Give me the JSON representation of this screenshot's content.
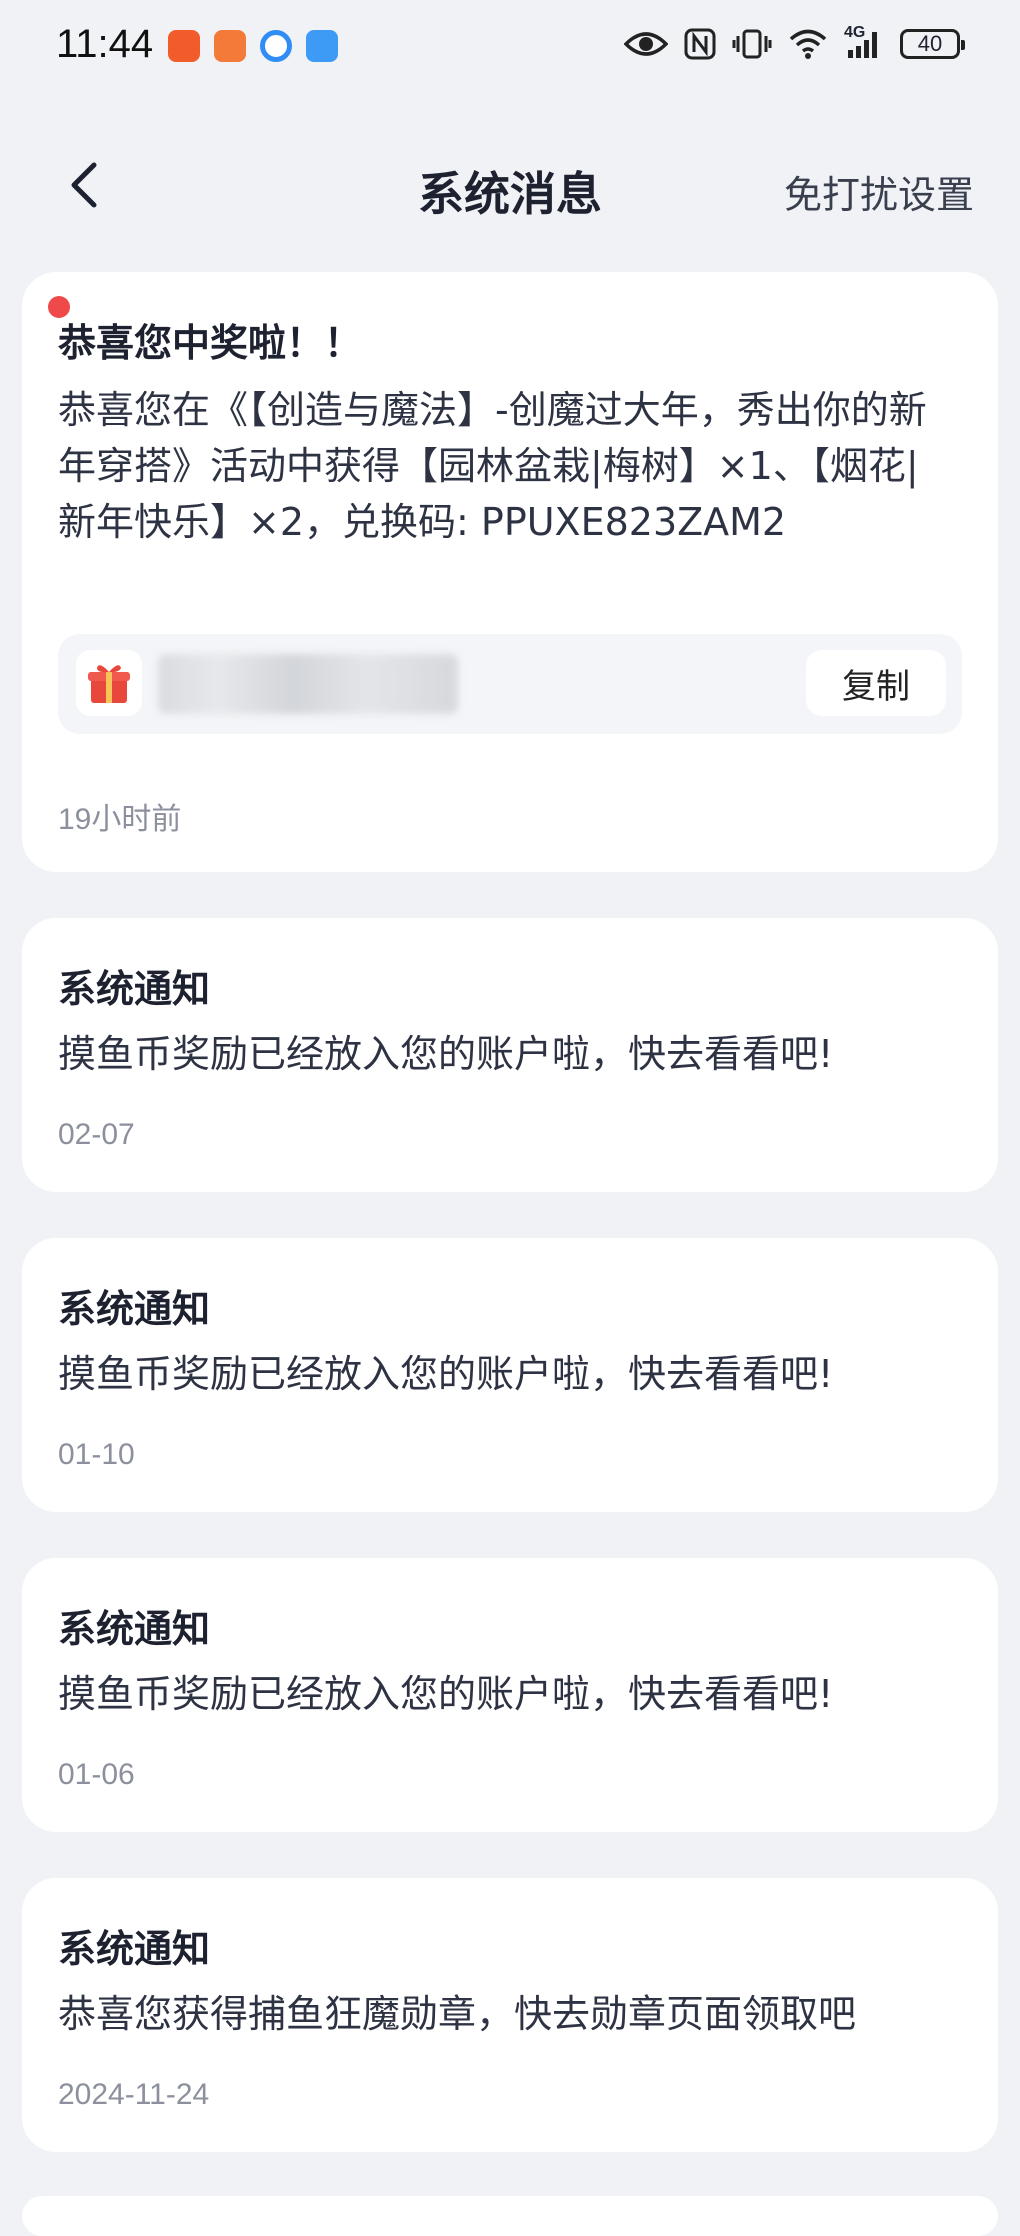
{
  "status_bar": {
    "time": "11:44",
    "battery": "40",
    "app_icons": [
      {
        "name": "app-icon-red",
        "color": "#f25c2a"
      },
      {
        "name": "app-icon-heart",
        "color": "#f47a3a"
      },
      {
        "name": "app-icon-blue-ring",
        "color": "#2f8df5"
      },
      {
        "name": "app-icon-weather",
        "color": "#3d9bf6"
      }
    ],
    "system_icons": [
      "eye-icon",
      "nfc-icon",
      "vibrate-icon",
      "wifi-icon",
      "signal-4g-icon",
      "battery-icon"
    ],
    "signal_label": "4G"
  },
  "nav": {
    "title": "系统消息",
    "action": "免打扰设置",
    "back_icon": "chevron-left-icon"
  },
  "messages": [
    {
      "title": "恭喜您中奖啦！！",
      "body": "恭喜您在《【创造与魔法】-创魔过大年，秀出你的新年穿搭》活动中获得【园林盆栽|梅树】×1、【烟花|新年快乐】×2，兑换码: PPUXE823ZAM2",
      "copy_label": "复制",
      "time": "19小时前",
      "unread": true
    },
    {
      "title": "系统通知",
      "body": "摸鱼币奖励已经放入您的账户啦，快去看看吧!",
      "time": "02-07"
    },
    {
      "title": "系统通知",
      "body": "摸鱼币奖励已经放入您的账户啦，快去看看吧!",
      "time": "01-10"
    },
    {
      "title": "系统通知",
      "body": "摸鱼币奖励已经放入您的账户啦，快去看看吧!",
      "time": "01-06"
    },
    {
      "title": "系统通知",
      "body": "恭喜您获得捕鱼狂魔勋章，快去勋章页面领取吧",
      "time": "2024-11-24"
    }
  ],
  "colors": {
    "background": "#f0f2f6",
    "card": "#ffffff",
    "unread_dot": "#f0494a",
    "gift_red": "#e8473c"
  }
}
